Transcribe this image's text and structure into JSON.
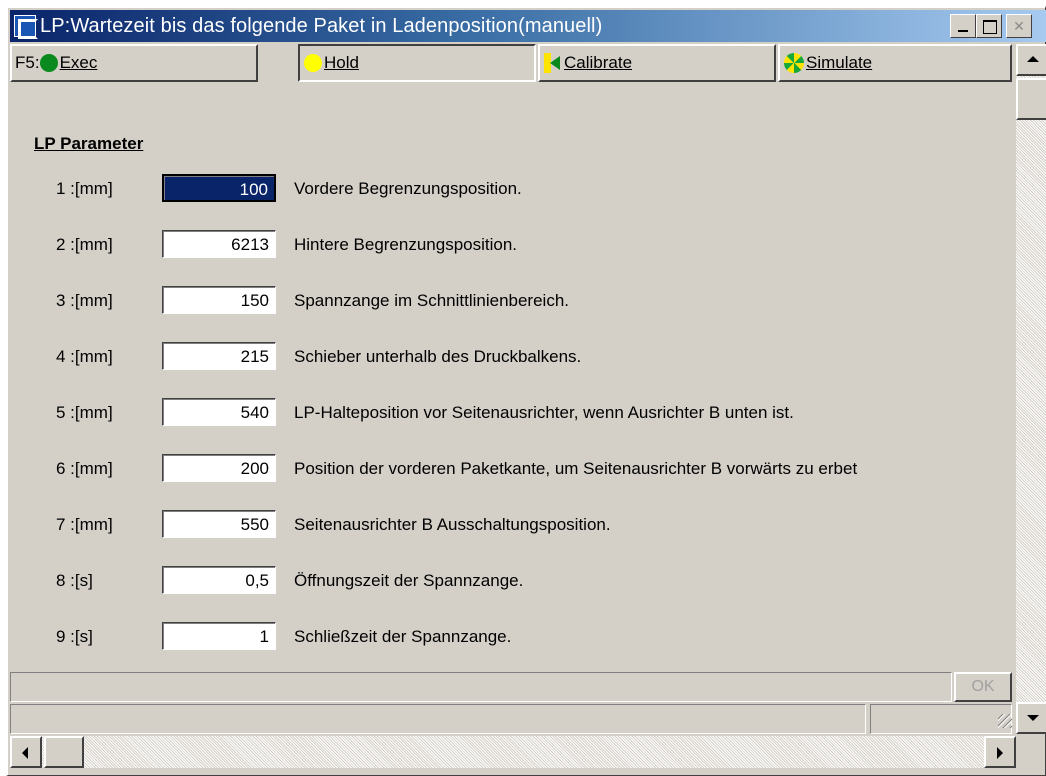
{
  "window": {
    "title": "LP:Wartezeit bis das folgende Paket in Ladenposition(manuell)"
  },
  "toolbar": {
    "f5_label": "F5:",
    "exec_label": "Exec",
    "exec_icon": "green-circle-icon",
    "hold_label": "Hold",
    "hold_icon": "yellow-circle-icon",
    "calibrate_label": "Calibrate",
    "calibrate_icon": "calibrate-icon",
    "simulate_label": "Simulate",
    "simulate_icon": "simulate-icon"
  },
  "section": {
    "title": "LP Parameter"
  },
  "params": [
    {
      "label": "1 :[mm]",
      "value": "100",
      "desc": "Vordere Begrenzungsposition."
    },
    {
      "label": "2 :[mm]",
      "value": "6213",
      "desc": "Hintere Begrenzungsposition."
    },
    {
      "label": "3 :[mm]",
      "value": "150",
      "desc": "Spannzange im Schnittlinienbereich."
    },
    {
      "label": "4 :[mm]",
      "value": "215",
      "desc": "Schieber unterhalb des Druckbalkens."
    },
    {
      "label": "5 :[mm]",
      "value": "540",
      "desc": "LP-Halteposition vor Seitenausrichter, wenn Ausrichter B unten ist."
    },
    {
      "label": "6 :[mm]",
      "value": "200",
      "desc": "Position der vorderen Paketkante, um Seitenausrichter B vorwärts zu erbet"
    },
    {
      "label": "7 :[mm]",
      "value": "550",
      "desc": "Seitenausrichter B Ausschaltungsposition."
    },
    {
      "label": "8 :[s]",
      "value": "0,5",
      "desc": "Öffnungszeit der Spannzange."
    },
    {
      "label": "9 :[s]",
      "value": "1",
      "desc": "Schließzeit der Spannzange."
    }
  ],
  "footer": {
    "ok_label": "OK"
  },
  "colors": {
    "selected_field": "#0a246a",
    "titlebar": "#0a246a",
    "window_bg": "#d4d0c8"
  }
}
